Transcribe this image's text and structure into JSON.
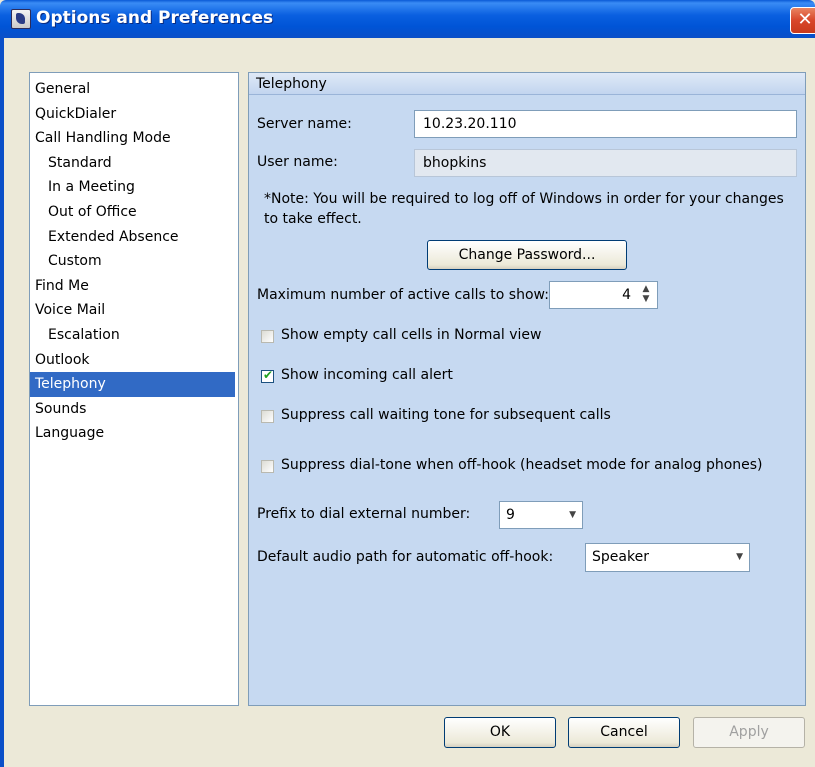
{
  "window": {
    "title": "Options and Preferences",
    "close_glyph": "✕",
    "icon": "app-phone-icon"
  },
  "nav": {
    "items": [
      {
        "label": "General",
        "level": 0
      },
      {
        "label": "QuickDialer",
        "level": 0
      },
      {
        "label": "Call Handling Mode",
        "level": 0
      },
      {
        "label": "Standard",
        "level": 1
      },
      {
        "label": "In a Meeting",
        "level": 1
      },
      {
        "label": "Out of Office",
        "level": 1
      },
      {
        "label": "Extended Absence",
        "level": 1
      },
      {
        "label": "Custom",
        "level": 1
      },
      {
        "label": "Find Me",
        "level": 0
      },
      {
        "label": "Voice Mail",
        "level": 0
      },
      {
        "label": "Escalation",
        "level": 1
      },
      {
        "label": "Outlook",
        "level": 0
      },
      {
        "label": "Telephony",
        "level": 0,
        "selected": true
      },
      {
        "label": "Sounds",
        "level": 0
      },
      {
        "label": "Language",
        "level": 0
      }
    ]
  },
  "panel": {
    "header": "Telephony",
    "server_label": "Server name:",
    "server_value": "10.23.20.110",
    "user_label": "User name:",
    "user_value": "bhopkins",
    "note": "*Note: You will be required to log off of Windows in order for your changes to take effect.",
    "change_password_label": "Change Password...",
    "max_calls_label": "Maximum number of active calls to show:",
    "max_calls_value": "4",
    "spin_up": "▲",
    "spin_down": "▼",
    "checkboxes": [
      {
        "label": "Show empty call cells in Normal view",
        "checked": false
      },
      {
        "label": "Show incoming call alert",
        "checked": true
      },
      {
        "label": "Suppress call waiting tone for subsequent calls",
        "checked": false
      },
      {
        "label": "Suppress dial-tone when off-hook (headset mode for analog phones)",
        "checked": false
      }
    ],
    "check_glyph": "✔",
    "prefix_label": "Prefix to dial external number:",
    "prefix_value": "9",
    "audio_label": "Default audio path for automatic off-hook:",
    "audio_value": "Speaker",
    "dropdown_glyph": "▼"
  },
  "footer": {
    "ok_label": "OK",
    "cancel_label": "Cancel",
    "apply_label": "Apply",
    "apply_enabled": false
  },
  "colors": {
    "titlebar": "#0054d6",
    "selection": "#316ac5",
    "panel_bg": "#c6d9f1",
    "window_bg": "#ece9d8"
  }
}
